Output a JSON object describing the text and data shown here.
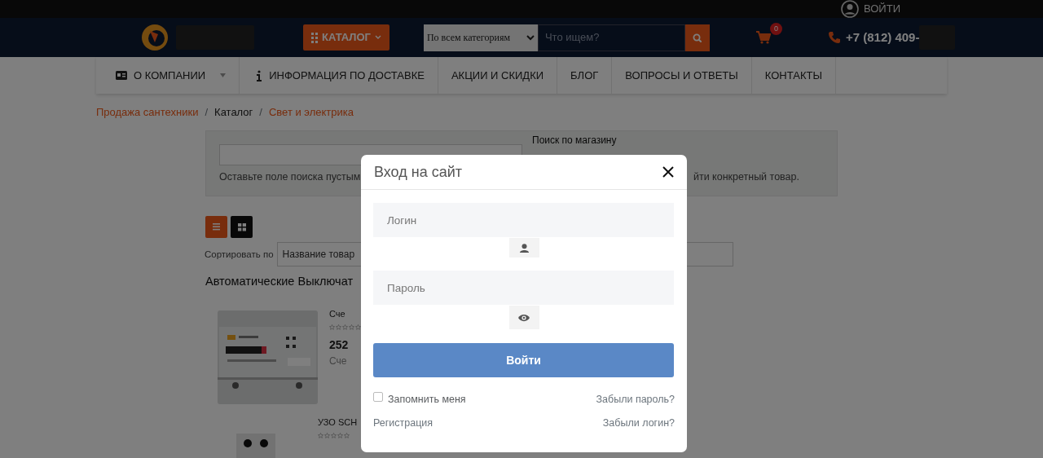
{
  "top_bar": {
    "login_link": "ВОЙТИ"
  },
  "header": {
    "catalog_button": "КАТАЛОГ",
    "search": {
      "category": "По всем категориям",
      "placeholder": "Что ищем?"
    },
    "cart_count": "0",
    "phone": "+7 (812) 409-"
  },
  "nav": [
    {
      "label": "О КОМПАНИИ",
      "kind": "card",
      "dropdown": true
    },
    {
      "label": "ИНФОРМАЦИЯ ПО ДОСТАВКЕ",
      "kind": "info",
      "dropdown": false
    },
    {
      "label": "АКЦИИ И СКИДКИ",
      "kind": "plain",
      "dropdown": false
    },
    {
      "label": "БЛОГ",
      "kind": "plain",
      "dropdown": false
    },
    {
      "label": "ВОПРОСЫ И ОТВЕТЫ",
      "kind": "plain",
      "dropdown": false
    },
    {
      "label": "КОНТАКТЫ",
      "kind": "plain",
      "dropdown": false
    }
  ],
  "breadcrumb": [
    {
      "label": "Продажа сантехники",
      "link": true
    },
    {
      "separator": "/",
      "label": "Каталог",
      "link": false
    },
    {
      "separator": "/",
      "label": "Свет и электрика",
      "link": true
    }
  ],
  "search_panel": {
    "title": "Поиск по магазину",
    "hint_left": "Оставьте поле поиска пустым",
    "hint_right": "йти конкретный товар."
  },
  "view_modes": [
    {
      "kind": "list",
      "selected": true
    },
    {
      "kind": "grid",
      "selected": false
    }
  ],
  "sort": {
    "label": "Сортировать по",
    "value": "Название товар"
  },
  "category_heading": "Автоматические Выключат",
  "products": [
    {
      "kind": "meter",
      "name": "Сче",
      "stars": 0,
      "price": "252",
      "description": "Сче"
    },
    {
      "kind": "device",
      "name": "УЗО SCH",
      "stars": 0
    }
  ],
  "modal": {
    "title": "Вход на сайт",
    "login_placeholder": "Логин",
    "password_placeholder": "Пароль",
    "submit": "Войти",
    "remember": {
      "label": "Запомнить меня",
      "checked": false
    },
    "forgot_password": "Забыли пароль?",
    "register": "Регистрация",
    "forgot_login": "Забыли логин?"
  }
}
